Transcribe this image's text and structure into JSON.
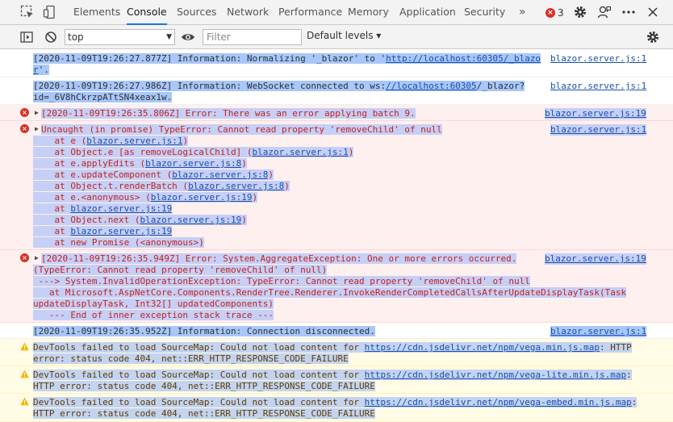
{
  "tabs": [
    {
      "label": "Elements"
    },
    {
      "label": "Console",
      "active": true
    },
    {
      "label": "Sources"
    },
    {
      "label": "Network"
    },
    {
      "label": "Performance"
    },
    {
      "label": "Memory"
    },
    {
      "label": "Application"
    },
    {
      "label": "Security"
    }
  ],
  "more_tabs": "»",
  "error_count": "3",
  "toolbar": {
    "context": "top",
    "filter_placeholder": "Filter",
    "levels": "Default levels ▾"
  },
  "messages": {
    "m1": {
      "l1a": "[2020-11-09T19:26:27.877Z] Information: Normalizing '_blazor' to '",
      "l1link": "http://localhost:60305/_blazo",
      "l2link": "r",
      "l2b": "'.",
      "src": "blazor.server.js:1"
    },
    "m2": {
      "l1a": "[2020-11-09T19:26:27.986Z] Information: WebSocket connected to ws:",
      "l1link": "//localhost:60305",
      "l1b": "/_blazor?",
      "l2": "id=_6V8hCkrzpATtSN4xeax1w.",
      "src": "blazor.server.js:1"
    },
    "m3": {
      "l1": "[2020-11-09T19:26:35.806Z] Error: There was an error applying batch 9.",
      "src": "blazor.server.js:19"
    },
    "m4": {
      "l1": "Uncaught (in promise) TypeError: Cannot read property 'removeChild' of null",
      "src": "blazor.server.js:1",
      "stack": [
        {
          "pre": "    at e (",
          "link": "blazor.server.js:1",
          "post": ")"
        },
        {
          "pre": "    at Object.e [as removeLogicalChild] (",
          "link": "blazor.server.js:1",
          "post": ")"
        },
        {
          "pre": "    at e.applyEdits (",
          "link": "blazor.server.js:8",
          "post": ")"
        },
        {
          "pre": "    at e.updateComponent (",
          "link": "blazor.server.js:8",
          "post": ")"
        },
        {
          "pre": "    at Object.t.renderBatch (",
          "link": "blazor.server.js:8",
          "post": ")"
        },
        {
          "pre": "    at e.<anonymous> (",
          "link": "blazor.server.js:19",
          "post": ")"
        },
        {
          "pre": "    at ",
          "link": "blazor.server.js:19",
          "post": ""
        },
        {
          "pre": "    at Object.next (",
          "link": "blazor.server.js:19",
          "post": ")"
        },
        {
          "pre": "    at ",
          "link": "blazor.server.js:19",
          "post": ""
        },
        {
          "pre": "    at new Promise (<anonymous>)",
          "link": "",
          "post": ""
        }
      ]
    },
    "m5": {
      "l1": "[2020-11-09T19:26:35.949Z] Error: System.AggregateException: One or more errors occurred.",
      "l2": "(TypeError: Cannot read property 'removeChild' of null)",
      "l3": " ---> System.InvalidOperationException: TypeError: Cannot read property 'removeChild' of null",
      "l4": "   at Microsoft.AspNetCore.Components.RenderTree.Renderer.InvokeRenderCompletedCallsAfterUpdateDisplayTask(Task",
      "l5": "updateDisplayTask, Int32[] updatedComponents)",
      "l6": "   --- End of inner exception stack trace ---",
      "src": "blazor.server.js:19"
    },
    "m6": {
      "l1": "[2020-11-09T19:26:35.952Z] Information: Connection disconnected.",
      "src": "blazor.server.js:1"
    },
    "w1": {
      "l1a": "DevTools failed to load SourceMap: Could not load content for ",
      "link": "https://cdn.jsdelivr.net/npm/vega.min.js.map",
      "l1b": ": HTTP",
      "l2": "error: status code 404, net::ERR_HTTP_RESPONSE_CODE_FAILURE"
    },
    "w2": {
      "l1a": "DevTools failed to load SourceMap: Could not load content for ",
      "link": "https://cdn.jsdelivr.net/npm/vega-lite.min.js.map",
      "l1b": ":",
      "l2": "HTTP error: status code 404, net::ERR_HTTP_RESPONSE_CODE_FAILURE"
    },
    "w3": {
      "l1a": "DevTools failed to load SourceMap: Could not load content for ",
      "link": "https://cdn.jsdelivr.net/npm/vega-embed.min.js.map",
      "l1b": ":",
      "l2": "HTTP error: status code 404, net::ERR_HTTP_RESPONSE_CODE_FAILURE"
    }
  },
  "colors": {
    "accent": "#1a73e8",
    "error": "#d93025",
    "warning": "#f2b600",
    "selection": "#a8c7fa"
  }
}
